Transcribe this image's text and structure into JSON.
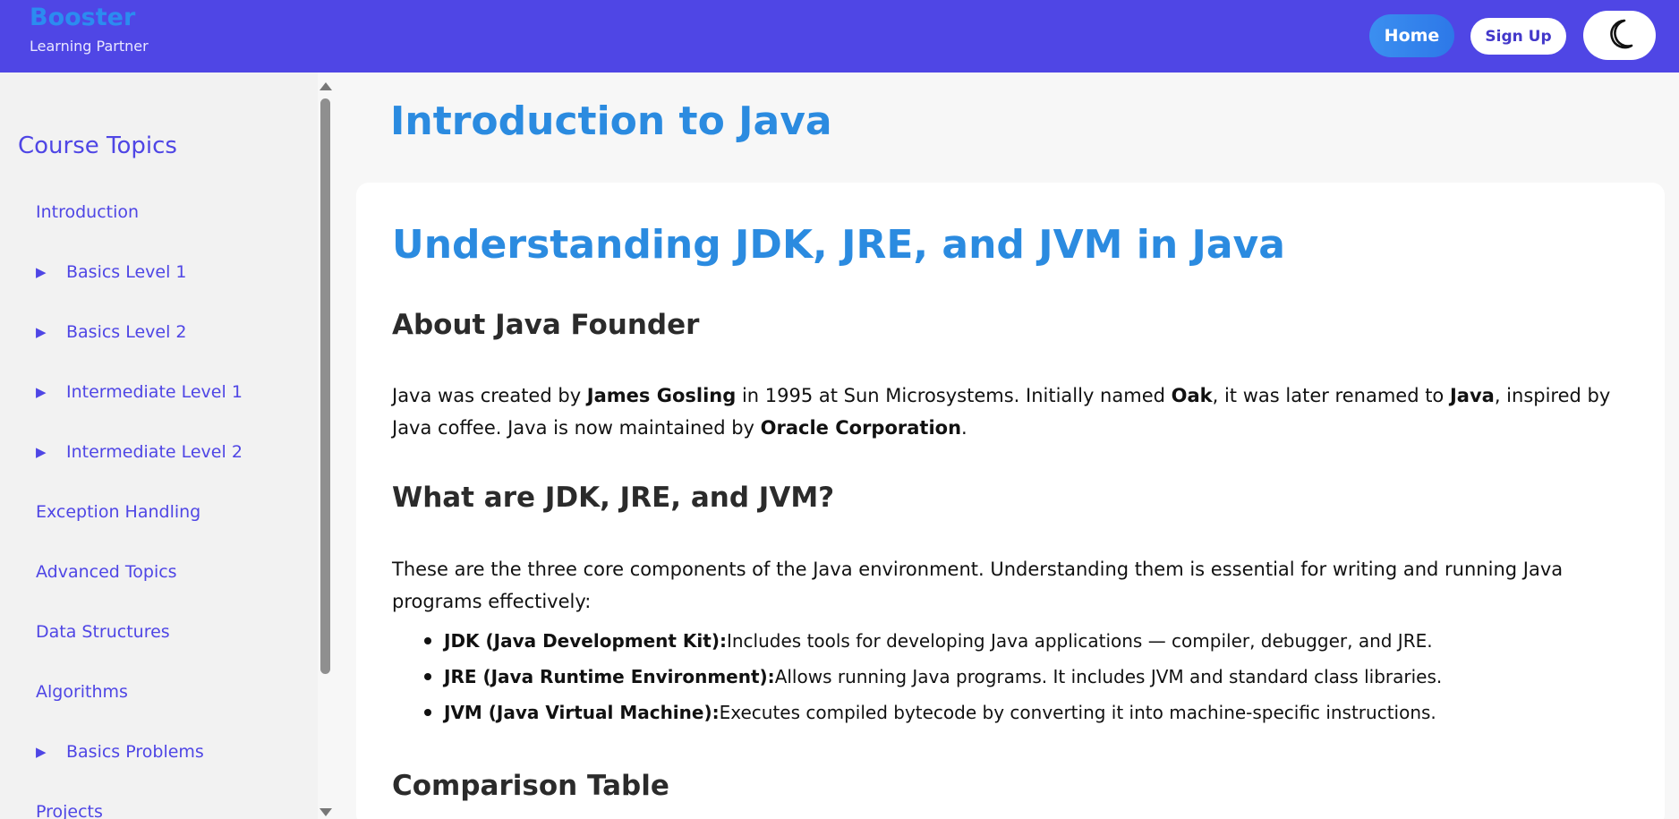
{
  "header": {
    "brand_name": "Booster",
    "brand_tagline": "Learning Partner",
    "home_label": "Home",
    "signup_label": "Sign Up",
    "theme_icon": "moon-icon"
  },
  "sidebar": {
    "title": "Course Topics",
    "items": [
      {
        "label": "Introduction",
        "expandable": false
      },
      {
        "label": "Basics Level 1",
        "expandable": true
      },
      {
        "label": "Basics Level 2",
        "expandable": true
      },
      {
        "label": "Intermediate Level 1",
        "expandable": true
      },
      {
        "label": "Intermediate Level 2",
        "expandable": true
      },
      {
        "label": "Exception Handling",
        "expandable": false
      },
      {
        "label": "Advanced Topics",
        "expandable": false
      },
      {
        "label": "Data Structures",
        "expandable": false
      },
      {
        "label": "Algorithms",
        "expandable": false
      },
      {
        "label": "Basics Problems",
        "expandable": true
      },
      {
        "label": "Projects",
        "expandable": false
      }
    ]
  },
  "main": {
    "page_title": "Introduction to Java",
    "card_title": "Understanding JDK, JRE, and JVM in Java",
    "section1_heading": "About Java Founder",
    "founder_text": {
      "t1": "Java was created by ",
      "b1": "James Gosling",
      "t2": " in 1995 at Sun Microsystems. Initially named ",
      "b2": "Oak",
      "t3": ", it was later renamed to ",
      "b3": "Java",
      "t4": ", inspired by Java coffee. Java is now maintained by ",
      "b4": "Oracle Corporation",
      "t5": "."
    },
    "section2_heading": "What are JDK, JRE, and JVM?",
    "section2_text": "These are the three core components of the Java environment. Understanding them is essential for writing and running Java programs effectively:",
    "components": [
      {
        "term": "JDK (Java Development Kit):",
        "desc": " Includes tools for developing Java applications — compiler, debugger, and JRE."
      },
      {
        "term": "JRE (Java Runtime Environment):",
        "desc": " Allows running Java programs. It includes JVM and standard class libraries."
      },
      {
        "term": "JVM (Java Virtual Machine):",
        "desc": " Executes compiled bytecode by converting it into machine-specific instructions."
      }
    ],
    "section3_heading": "Comparison Table"
  },
  "colors": {
    "header_bg": "#4f46e5",
    "accent_blue": "#2b8be0",
    "sidebar_text": "#4f46e5"
  }
}
